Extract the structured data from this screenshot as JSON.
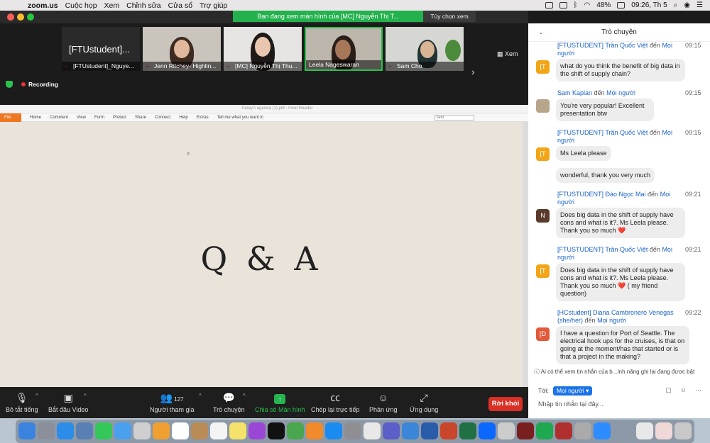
{
  "menubar": {
    "app_name": "zoom.us",
    "items": [
      "Cuộc họp",
      "Xem",
      "Chỉnh sửa",
      "Cửa sổ",
      "Trợ giúp"
    ],
    "battery": "48%",
    "clock": "09:26, Th 5"
  },
  "share_banner": {
    "text": "Bạn đang xem màn hình của [MC] Nguyễn Thị T...",
    "options_label": "Tùy chọn xem"
  },
  "video_strip": {
    "view_label": "Xem",
    "tiles": [
      {
        "name": "[FTUstudent]_Nguye...",
        "big_label": "[FTUstudent]..."
      },
      {
        "name": "Jenn Ritchey- Highlin..."
      },
      {
        "name": "[MC] Nguyễn Thị Thu..."
      },
      {
        "name": "Leela Nageswaran"
      },
      {
        "name": "Sam Cho"
      }
    ],
    "recording_label": "Recording"
  },
  "shared_screen": {
    "document_title": "Today's agenda (1).pdf - Foxit Reader",
    "tabs": [
      "File",
      "Home",
      "Comment",
      "View",
      "Form",
      "Protect",
      "Share",
      "Connect",
      "Help",
      "Extras"
    ],
    "tell_me": "Tell me what you want tc",
    "find_placeholder": "Find",
    "slide_text": "Q & A"
  },
  "toolbar": {
    "mute": "Bỏ tắt tiếng",
    "video": "Bắt đầu Video",
    "participants": "Người tham gia",
    "participant_count": "127",
    "chat": "Trò chuyện",
    "share": "Chia sẻ Màn hình",
    "cc": "Chép lại trực tiếp",
    "reactions": "Phản ứng",
    "apps": "Ứng dụng",
    "leave": "Rời khỏi"
  },
  "chat": {
    "title": "Trò chuyện",
    "messages": [
      {
        "sender": "[FTUSTUDENT] Trần Quốc Việt",
        "to": "đến",
        "recipient": "Mọi người",
        "time": "09:15",
        "avatar": "[T",
        "text": "what do you think the benefit of big data in the shift of supply chain?"
      },
      {
        "sender": "Sam Kaplan",
        "to": "đến",
        "recipient": "Mọi người",
        "time": "09:15",
        "avatar": "",
        "text": "You're very popular! Excellent presentation btw"
      },
      {
        "sender": "[FTUSTUDENT] Trần Quốc Việt",
        "to": "đến",
        "recipient": "Mọi người",
        "time": "09:15",
        "avatar": "[T",
        "text": "Ms Leela please",
        "text2": "wonderful, thank you very much"
      },
      {
        "sender": "[FTUSTUDENT] Đào Ngọc Mai",
        "to": "đến",
        "recipient": "Mọi người",
        "time": "09:21",
        "avatar": "N",
        "text": "Does big data in the shift of supply have cons and what is it?. Ms Leela please. Thank you so much",
        "heart": "❤️"
      },
      {
        "sender": "[FTUSTUDENT] Trần Quốc Việt",
        "to": "đến",
        "recipient": "Mọi người",
        "time": "09:21",
        "avatar": "[T",
        "text": "Does big data in the shift of supply have cons and what is it?. Ms Leela please. Thank you so much",
        "heart": "❤️",
        "suffix": "( my friend question)"
      },
      {
        "sender": "[HCstudent] Diana Cambronero Venegas (she/her)",
        "to": "đến",
        "recipient": "Mọi người",
        "time": "09:22",
        "avatar": "[D",
        "text": "I have a question for Port of Seattle. The electrical hook ups for the cruises, is that on going at the moment/has that started or is that a project in the making?"
      }
    ],
    "notice": "Ai có thể xem tin nhắn của b...ính năng ghi lại đang được bật",
    "to_label": "Tới:",
    "to_recipient": "Mọi người",
    "input_placeholder": "Nhập tin nhắn tại đây..."
  },
  "colors": {
    "share_green": "#23b14d",
    "leave_red": "#d93025",
    "link_blue": "#1a63c5"
  }
}
